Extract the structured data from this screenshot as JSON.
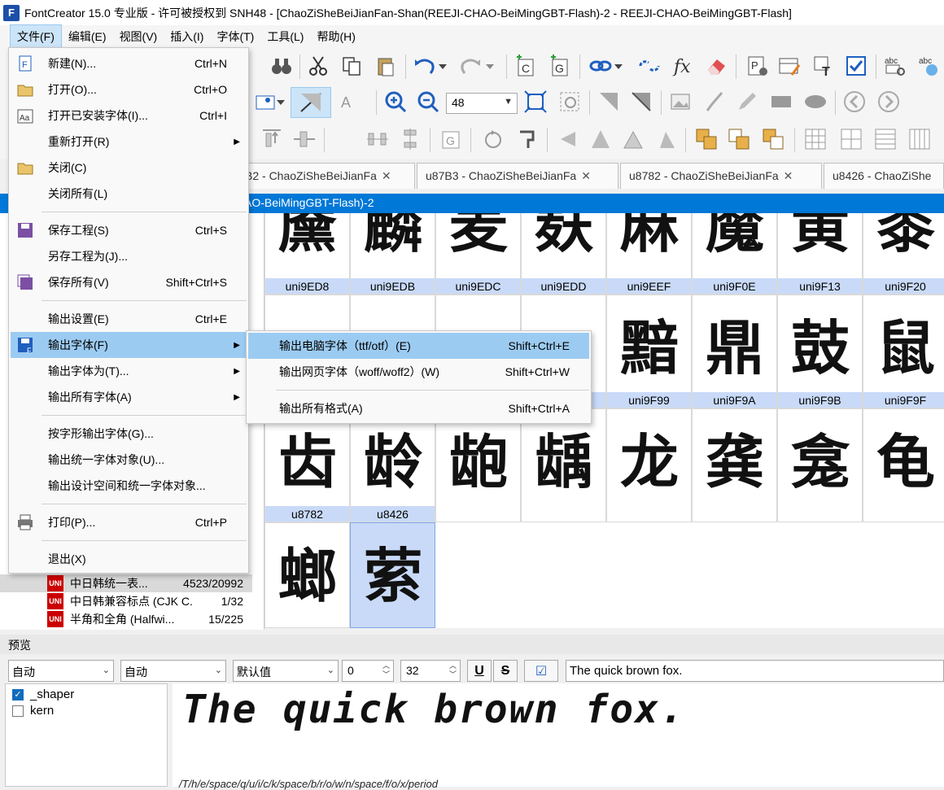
{
  "window": {
    "title": "FontCreator 15.0 专业版 - 许可被授权到 SNH48 - [ChaoZiSheBeiJianFan-Shan(REEJI-CHAO-BeiMingGBT-Flash)-2 - REEJI-CHAO-BeiMingGBT-Flash]",
    "app_icon": "F"
  },
  "menubar": [
    "文件(F)",
    "编辑(E)",
    "视图(V)",
    "插入(I)",
    "字体(T)",
    "工具(L)",
    "帮助(H)"
  ],
  "toolbar": {
    "zoom_value": "48"
  },
  "tabs": [
    {
      "label": "B2 - ChaoZiSheBeiJianFa"
    },
    {
      "label": "u87B3 - ChaoZiSheBeiJianFa"
    },
    {
      "label": "u8782 - ChaoZiSheBeiJianFa"
    },
    {
      "label": "u8426 - ChaoZiShe"
    }
  ],
  "glyph_panel": {
    "title": "AO-BeiMingGBT-Flash)-2",
    "rows": [
      {
        "label_row": [
          "uni9ED8",
          "uni9EDB",
          "uni9EDC",
          "uni9EDD",
          "uni9EEF",
          "uni9F0E",
          "uni9F13",
          "uni9F20"
        ],
        "glyphs": [
          "黡",
          "麟",
          "麦",
          "麸",
          "麻",
          "魔",
          "黄",
          "黍"
        ]
      },
      {
        "label_row": [
          "",
          "",
          "",
          "",
          "uni9F99",
          "uni9F9A",
          "uni9F9B",
          "uni9F9F"
        ],
        "glyphs": [
          "",
          "",
          "",
          "",
          "黯",
          "鼎",
          "鼓",
          "鼠"
        ]
      },
      {
        "label_row": [
          "u8782",
          "u8426"
        ],
        "glyphs": [
          "齿",
          "龄",
          "龅",
          "龋",
          "龙",
          "龚",
          "龛",
          "龟"
        ]
      },
      {
        "glyphs": [
          "螂",
          "萦"
        ]
      }
    ]
  },
  "tree": [
    {
      "name": "中日韩统一表...",
      "count": "4523/20992",
      "icon": "unicode-icon"
    },
    {
      "name": "中日韩兼容标点 (CJK C...",
      "count": "1/32",
      "icon": "unicode-icon"
    },
    {
      "name": "半角和全角 (Halfwi...",
      "count": "15/225",
      "icon": "unicode-icon"
    }
  ],
  "preview": {
    "title": "预览",
    "combo1": "自动",
    "combo2": "自动",
    "combo3": "默认值",
    "spin1": "0",
    "spin2": "32",
    "underline_label": "U",
    "strike_label": "S",
    "text_value": "The quick brown fox.",
    "features": [
      {
        "name": "_shaper",
        "checked": true
      },
      {
        "name": "kern",
        "checked": false
      }
    ],
    "sample": "The quick brown fox.",
    "glyph_names": "/T/h/e/space/q/u/i/c/k/space/b/r/o/w/n/space/f/o/x/period"
  },
  "file_menu": {
    "items": [
      {
        "label": "新建(N)...",
        "shortcut": "Ctrl+N",
        "icon": "new-file-icon"
      },
      {
        "label": "打开(O)...",
        "shortcut": "Ctrl+O",
        "icon": "open-folder-icon"
      },
      {
        "label": "打开已安装字体(I)...",
        "shortcut": "Ctrl+I",
        "icon": "installed-font-icon"
      },
      {
        "label": "重新打开(R)",
        "shortcut": "",
        "icon": "",
        "submenu": true
      },
      {
        "label": "关闭(C)",
        "shortcut": "",
        "icon": "close-folder-icon"
      },
      {
        "label": "关闭所有(L)",
        "shortcut": "",
        "icon": ""
      },
      {
        "label": "保存工程(S)",
        "shortcut": "Ctrl+S",
        "icon": "save-icon"
      },
      {
        "label": "另存工程为(J)...",
        "shortcut": "",
        "icon": ""
      },
      {
        "label": "保存所有(V)",
        "shortcut": "Shift+Ctrl+S",
        "icon": "save-all-icon"
      },
      {
        "label": "输出设置(E)",
        "shortcut": "Ctrl+E",
        "icon": ""
      },
      {
        "label": "输出字体(F)",
        "shortcut": "",
        "icon": "export-font-icon",
        "submenu": true
      },
      {
        "label": "输出字体为(T)...",
        "shortcut": "",
        "icon": "",
        "submenu": true
      },
      {
        "label": "输出所有字体(A)",
        "shortcut": "",
        "icon": "",
        "submenu": true
      },
      {
        "label": "按字形输出字体(G)...",
        "shortcut": "",
        "icon": ""
      },
      {
        "label": "输出统一字体对象(U)...",
        "shortcut": "",
        "icon": ""
      },
      {
        "label": "输出设计空间和统一字体对象...",
        "shortcut": "",
        "icon": ""
      },
      {
        "label": "打印(P)...",
        "shortcut": "Ctrl+P",
        "icon": "printer-icon"
      },
      {
        "label": "退出(X)",
        "shortcut": "",
        "icon": ""
      }
    ]
  },
  "export_submenu": {
    "items": [
      {
        "label": "输出电脑字体（ttf/otf）(E)",
        "shortcut": "Shift+Ctrl+E"
      },
      {
        "label": "输出网页字体（woff/woff2）(W)",
        "shortcut": "Shift+Ctrl+W"
      },
      {
        "label": "输出所有格式(A)",
        "shortcut": "Shift+Ctrl+A"
      }
    ]
  },
  "colors": {
    "accent": "#0078d7",
    "menu_highlight": "#9ccbf2",
    "glyph_label_bg": "#c9daf8",
    "unicode_icon": "#cc0000"
  }
}
